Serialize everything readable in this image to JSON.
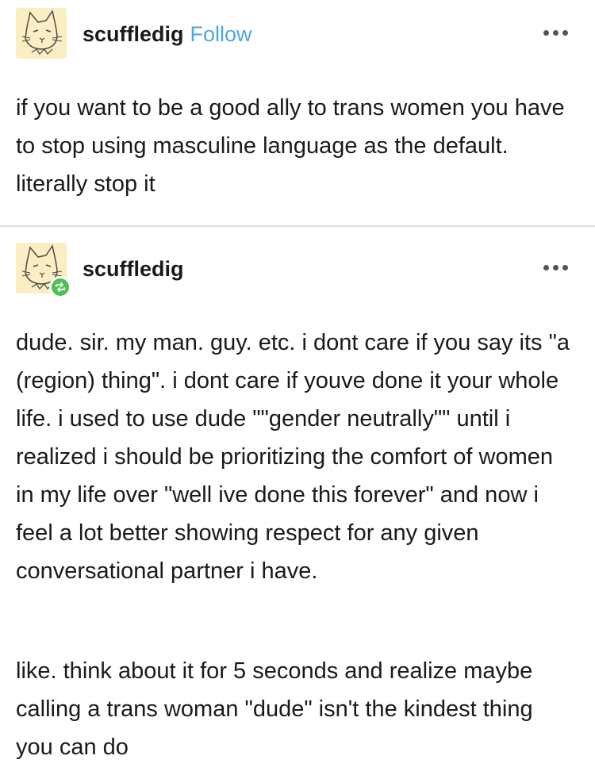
{
  "original_post": {
    "username": "scuffledig",
    "follow_label": "Follow",
    "avatar_icon": "cat-avatar-icon",
    "menu_icon": "more-options-icon",
    "text": "if you want to be a good ally to trans women you have to stop using masculine language as the default. literally stop it"
  },
  "reblog": {
    "username": "scuffledig",
    "avatar_icon": "cat-avatar-icon",
    "badge_icon": "reblog-icon",
    "badge_color": "#4cc256",
    "menu_icon": "more-options-icon",
    "paragraphs": [
      "dude. sir. my man. guy. etc. i dont care if you say its \"a (region) thing\". i dont care if youve done it your whole life. i used to use dude \"\"gender neutrally\"\" until i realized i should be prioritizing the comfort of women in my life over \"well ive done this forever\" and now i feel a lot better showing respect for any given conversational partner i have.",
      "like. think about it for 5 seconds and realize maybe calling a trans woman \"dude\" isn't the kindest thing you can do"
    ]
  },
  "colors": {
    "follow": "#4ea6e6",
    "avatar_bg": "#fbeec2",
    "divider": "#dddddd"
  }
}
